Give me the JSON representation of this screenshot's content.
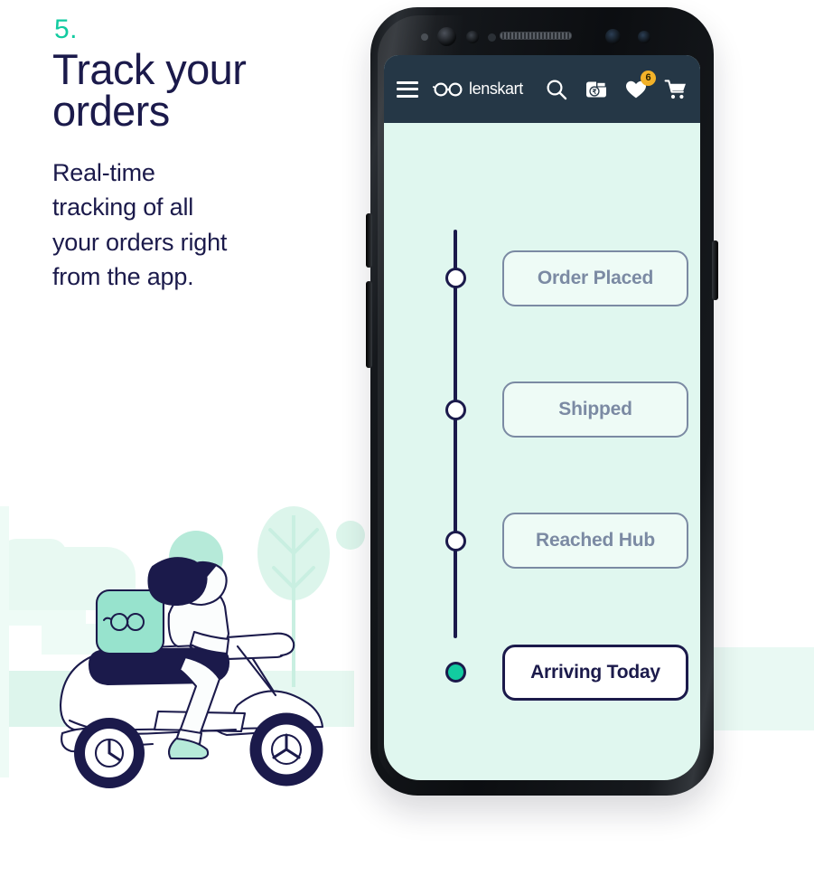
{
  "slide": {
    "step_number": "5.",
    "headline": "Track your\norders",
    "body": "Real-time\ntracking of all\nyour orders right\nfrom the app."
  },
  "colors": {
    "accent_teal": "#12cba0",
    "navy": "#1b1a4b",
    "appbar": "#253746",
    "screen_bg": "#e0f7ef",
    "pill_border_inactive": "#7b8aa3",
    "badge_yellow": "#f3b229",
    "mint_soft": "#d9f4ea"
  },
  "appbar": {
    "menu_icon": "hamburger-menu-icon",
    "brand_name": "lenskart",
    "brand_icon": "lenskart-glasses-logo-icon",
    "search_icon": "search-icon",
    "wallet_icon": "wallet-rupee-icon",
    "wishlist_icon": "heart-icon",
    "wishlist_badge": "6",
    "cart_icon": "shopping-cart-icon"
  },
  "tracking": {
    "steps": [
      {
        "label": "Order Placed",
        "state": "pending"
      },
      {
        "label": "Shipped",
        "state": "pending"
      },
      {
        "label": "Reached Hub",
        "state": "pending"
      },
      {
        "label": "Arriving Today",
        "state": "active"
      }
    ]
  },
  "illustration": {
    "name": "delivery-scooter-illustration",
    "rider": "delivery-rider",
    "box_logo": "lenskart-glasses-logo-icon",
    "scenery": [
      "tree-shape",
      "cloud-shape",
      "ground-band"
    ]
  }
}
